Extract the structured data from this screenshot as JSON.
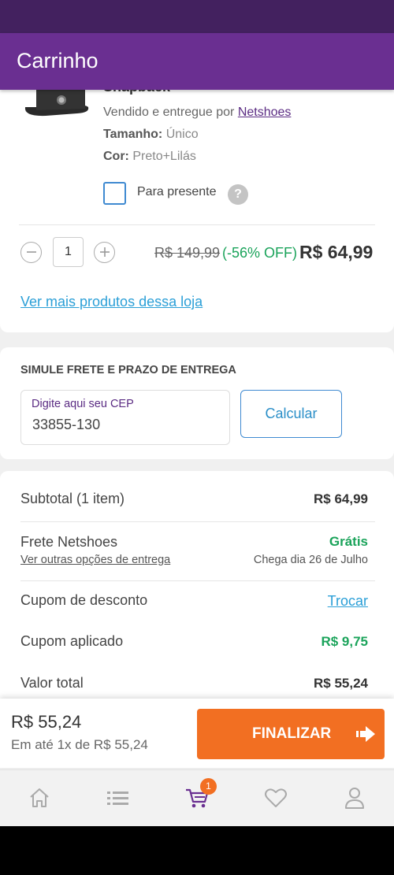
{
  "header": {
    "title": "Carrinho"
  },
  "product": {
    "name": "Snapback",
    "seller_prefix": "Vendido e entregue por ",
    "seller_name": "Netshoes",
    "size_label": "Tamanho:",
    "size_value": "Único",
    "color_label": "Cor:",
    "color_value": "Preto+Lilás",
    "gift_label": "Para presente",
    "help_glyph": "?",
    "quantity": "1",
    "price_old": "R$ 149,99",
    "discount": "(-56% OFF)",
    "price_new": "R$ 64,99",
    "more_link": "Ver mais produtos dessa loja"
  },
  "shipping": {
    "title": "SIMULE FRETE E PRAZO DE ENTREGA",
    "cep_label": "Digite aqui seu CEP",
    "cep_value": "33855-130",
    "button": "Calcular"
  },
  "summary": {
    "subtotal_label": "Subtotal (1 item)",
    "subtotal_value": "R$ 64,99",
    "frete_label": "Frete Netshoes",
    "frete_value": "Grátis",
    "frete_link": "Ver outras opções de entrega",
    "frete_date": "Chega dia 26 de Julho",
    "cupom_label": "Cupom de desconto",
    "cupom_action": "Trocar",
    "cupom_aplicado_label": "Cupom aplicado",
    "cupom_aplicado_value": "R$ 9,75",
    "total_label": "Valor total",
    "total_value": "R$ 55,24"
  },
  "footer": {
    "total": "R$ 55,24",
    "installments": "Em até 1x de R$ 55,24",
    "button": "FINALIZAR"
  },
  "nav": {
    "items": [
      "home-icon",
      "list-icon",
      "cart-icon",
      "heart-icon",
      "profile-icon"
    ],
    "cart_badge": "1",
    "active_color": "#6a2f91"
  },
  "colors": {
    "brand": "#6a2f91",
    "accent": "#f26f22",
    "success": "#1aa35a",
    "link": "#2b9fd7"
  }
}
